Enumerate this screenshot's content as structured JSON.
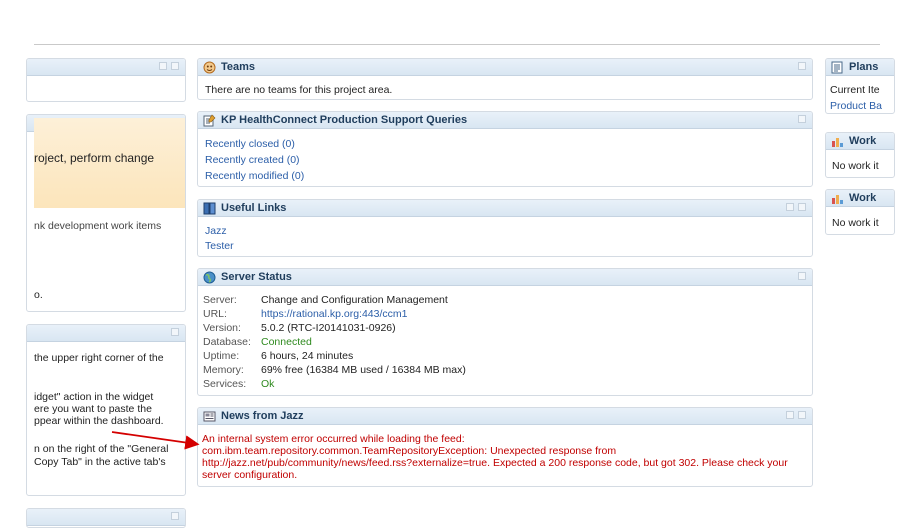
{
  "left": {
    "mid_text_1": "roject, perform change",
    "mid_text_2": "nk development work items",
    "mid_text_3": "o.",
    "bottom_lines": [
      "the upper right corner of the",
      "idget\" action in the widget",
      "ere you want to paste the",
      "ppear within the dashboard.",
      "n on the right of the \"General",
      "Copy Tab\" in the active tab's"
    ]
  },
  "teams": {
    "title": "Teams",
    "message": "There are no teams for this project area."
  },
  "queries": {
    "title": "KP HealthConnect Production Support Queries",
    "items": [
      "Recently closed (0)",
      "Recently created (0)",
      "Recently modified (0)"
    ]
  },
  "links": {
    "title": "Useful Links",
    "items": [
      "Jazz",
      "Tester"
    ]
  },
  "server": {
    "title": "Server Status",
    "rows": [
      {
        "label": "Server:",
        "value": "Change and Configuration Management"
      },
      {
        "label": "URL:",
        "value": "https://rational.kp.org:443/ccm1"
      },
      {
        "label": "Version:",
        "value": "5.0.2 (RTC-I20141031-0926)"
      },
      {
        "label": "Database:",
        "value": "Connected"
      },
      {
        "label": "Uptime:",
        "value": "6 hours, 24 minutes"
      },
      {
        "label": "Memory:",
        "value": "69% free (16384 MB used / 16384 MB max)"
      },
      {
        "label": "Services:",
        "value": "Ok"
      }
    ]
  },
  "news": {
    "title": "News from Jazz",
    "error_lines": [
      "An internal system error occurred while loading the feed:",
      "com.ibm.team.repository.common.TeamRepositoryException: Unexpected response from",
      "http://jazz.net/pub/community/news/feed.rss?externalize=true. Expected a 200 response code, but got 302. Please check your",
      "server configuration."
    ]
  },
  "right": {
    "plans_title": "Plans",
    "plans_items": [
      "Current Ite",
      "Product Ba"
    ],
    "work1_title": "Work",
    "work1_text": "No work it",
    "work2_title": "Work",
    "work2_text": "No work it"
  },
  "colors": {
    "link": "#2b5ea8",
    "error": "#c00000",
    "ok": "#2f8a1f",
    "header": "#1f3d5c",
    "annotation_arrow": "#d40000"
  }
}
